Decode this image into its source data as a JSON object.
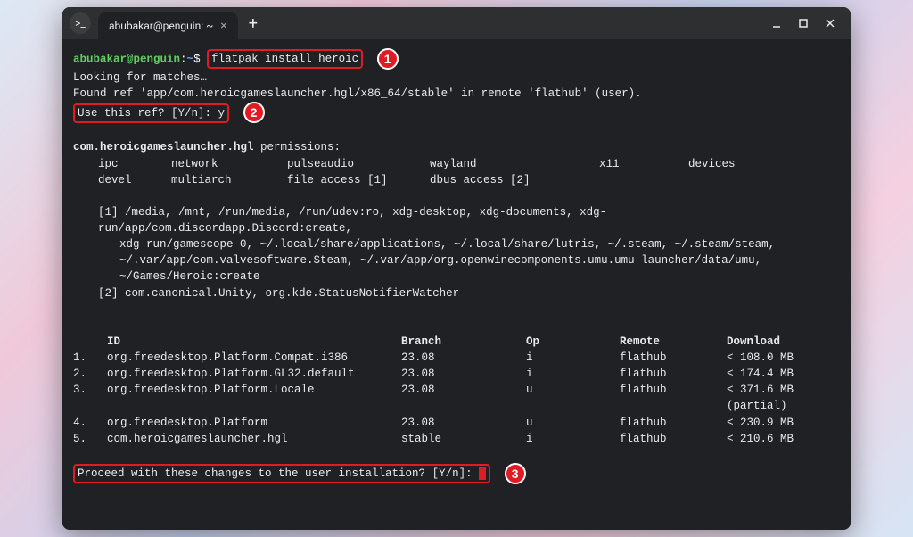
{
  "tab": {
    "title": "abubakar@penguin: ~"
  },
  "prompt": {
    "user": "abubakar@penguin",
    "path": "~",
    "symbol": "$",
    "command": "flatpak install heroic"
  },
  "lines": {
    "looking": "Looking for matches…",
    "found": "Found ref 'app/com.heroicgameslauncher.hgl/x86_64/stable' in remote 'flathub' (user).",
    "useref": "Use this ref? [Y/n]: y",
    "permheader_pkg": "com.heroicgameslauncher.hgl",
    "permheader_suffix": " permissions:",
    "note1_label": "[1]",
    "note1_a": "/media, /mnt, /run/media, /run/udev:ro, xdg-desktop, xdg-documents, xdg-run/app/com.discordapp.Discord:create,",
    "note1_b": "xdg-run/gamescope-0, ~/.local/share/applications, ~/.local/share/lutris, ~/.steam, ~/.steam/steam,",
    "note1_c": "~/.var/app/com.valvesoftware.Steam, ~/.var/app/org.openwinecomponents.umu.umu-launcher/data/umu, ~/Games/Heroic:create",
    "note2_label": "[2]",
    "note2": "com.canonical.Unity, org.kde.StatusNotifierWatcher",
    "proceed": "Proceed with these changes to the user installation? [Y/n]: "
  },
  "perms": {
    "r1": {
      "c1": "ipc",
      "c2": "network",
      "c3": "pulseaudio",
      "c4": "wayland",
      "c5": "x11",
      "c6": "devices"
    },
    "r2": {
      "c1": "devel",
      "c2": "multiarch",
      "c3": "file access [1]",
      "c4": "dbus access [2]"
    }
  },
  "table": {
    "headers": {
      "id": "ID",
      "branch": "Branch",
      "op": "Op",
      "remote": "Remote",
      "download": "Download"
    },
    "rows": [
      {
        "n": "1.",
        "id": "org.freedesktop.Platform.Compat.i386",
        "branch": "23.08",
        "op": "i",
        "remote": "flathub",
        "download": "< 108.0 MB"
      },
      {
        "n": "2.",
        "id": "org.freedesktop.Platform.GL32.default",
        "branch": "23.08",
        "op": "i",
        "remote": "flathub",
        "download": "< 174.4 MB"
      },
      {
        "n": "3.",
        "id": "org.freedesktop.Platform.Locale",
        "branch": "23.08",
        "op": "u",
        "remote": "flathub",
        "download": "< 371.6 MB (partial)"
      },
      {
        "n": "4.",
        "id": "org.freedesktop.Platform",
        "branch": "23.08",
        "op": "u",
        "remote": "flathub",
        "download": "< 230.9 MB"
      },
      {
        "n": "5.",
        "id": "com.heroicgameslauncher.hgl",
        "branch": "stable",
        "op": "i",
        "remote": "flathub",
        "download": "< 210.6 MB"
      }
    ]
  },
  "callouts": {
    "c1": "1",
    "c2": "2",
    "c3": "3"
  }
}
